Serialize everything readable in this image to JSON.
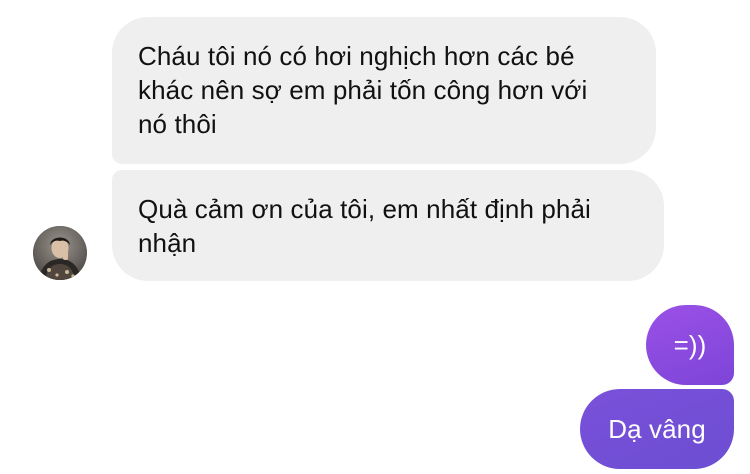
{
  "conversation": {
    "incoming": [
      {
        "lines": [
          "Cháu tôi nó có hơi nghịch hơn các bé",
          "khác nên sợ em phải tốn công hơn với",
          "nó thôi"
        ]
      },
      {
        "lines": [
          "Quà cảm ơn của tôi, em nhất định phải",
          "nhận"
        ]
      }
    ],
    "outgoing": [
      {
        "text": "=))"
      },
      {
        "text": "Dạ vâng"
      }
    ]
  },
  "contact": {
    "avatar_icon": "profile-photo-icon"
  },
  "colors": {
    "incoming_bubble": "#efeff0",
    "outgoing_bubble_top": "#9b50e6",
    "outgoing_bubble_bottom": "#6c4ed2",
    "outgoing_text": "#ffffff"
  }
}
